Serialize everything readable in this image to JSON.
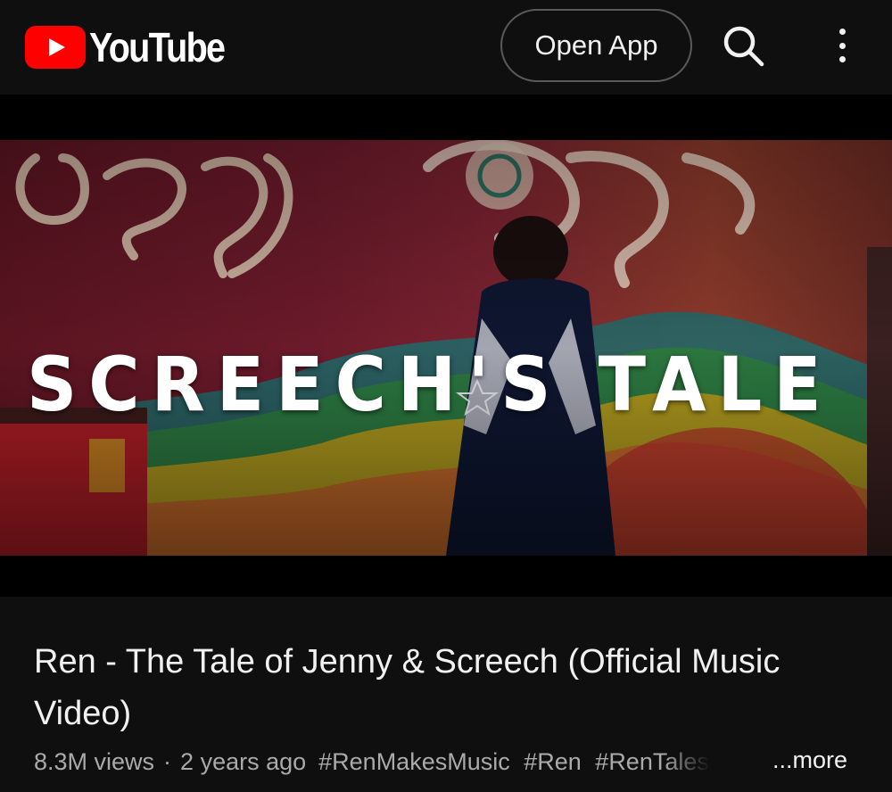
{
  "header": {
    "logo_text": "YouTube",
    "open_app_label": "Open App",
    "brand_color": "#ff0000"
  },
  "icons": {
    "logo": "youtube-play-icon",
    "search": "search-icon",
    "menu": "more-vertical-icon"
  },
  "player": {
    "overlay_text": "SCREECH'S TALE"
  },
  "video": {
    "title": "Ren - The Tale of Jenny & Screech (Official Music Video)",
    "views": "8.3M views",
    "separator": "·",
    "age": "2 years ago",
    "hashtags": [
      "#RenMakesMusic",
      "#Ren",
      "#RenTales"
    ],
    "more_label": "...more"
  }
}
